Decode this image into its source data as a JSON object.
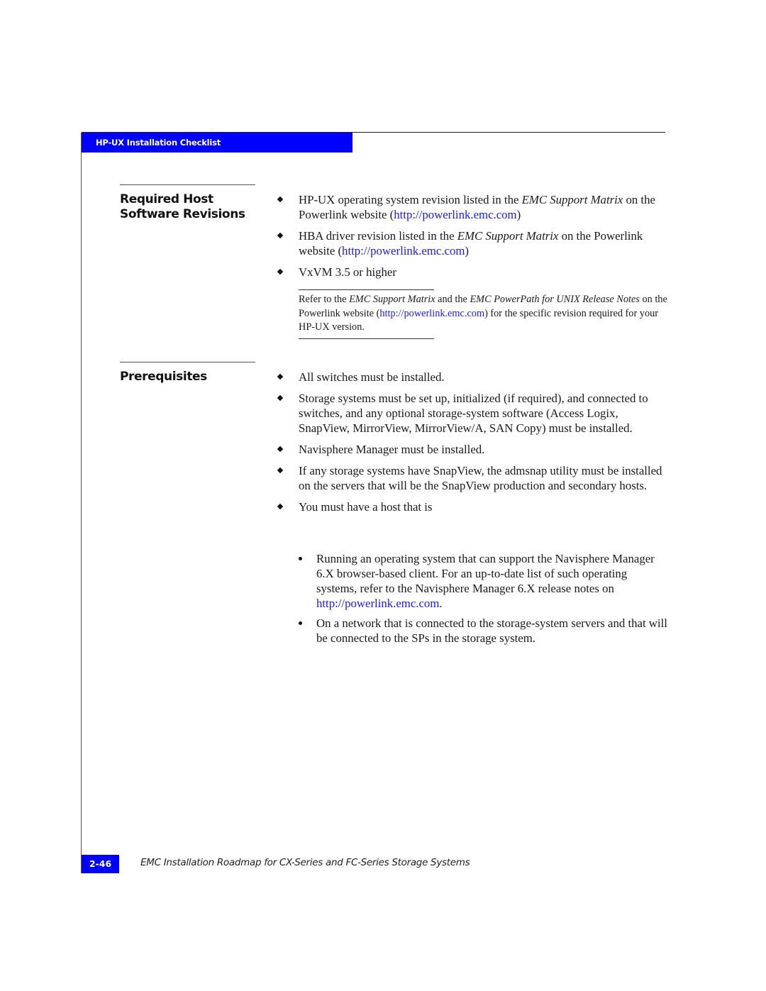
{
  "header": {
    "section_banner": "HP-UX Installation Checklist",
    "banner_color": "#0000ff"
  },
  "sections": {
    "required_host": {
      "heading_line1": "Required Host",
      "heading_line2": "Software Revisions",
      "items": [
        {
          "pre": "HP-UX operating system revision listed in the ",
          "em": "EMC Support Matrix",
          "mid": " on the Powerlink website (",
          "link": "http://powerlink.emc.com",
          "post": ")"
        },
        {
          "pre": "HBA driver revision listed in the ",
          "em": "EMC Support Matrix",
          "mid": " on the Powerlink website (",
          "link": "http://powerlink.emc.com",
          "post": ")"
        },
        {
          "text": "VxVM 3.5 or higher"
        }
      ],
      "note": {
        "t1": "Refer to the ",
        "em1": "EMC Support Matrix",
        "t2": " and the ",
        "em2": "EMC PowerPath for UNIX Release Notes",
        "t3": " on the Powerlink website (",
        "link": "http://powerlink.emc.com",
        "t4": ") for the specific revision required for your HP-UX version."
      }
    },
    "prerequisites": {
      "heading": "Prerequisites",
      "items": [
        "All switches must be installed.",
        "Storage systems must be set up, initialized (if required), and connected to switches, and any optional storage-system software (Access Logix, SnapView, MirrorView, MirrorView/A, SAN Copy) must be installed.",
        "Navisphere Manager must be installed.",
        "If any storage systems have SnapView, the admsnap utility must be installed on the servers that will be the SnapView production and secondary hosts.",
        "You must have a host that is"
      ],
      "subitems": [
        {
          "pre": "Running an operating system that can support the Navisphere Manager 6.X browser-based client. For an up-to-date list of such operating systems, refer to the Navisphere Manager 6.X release notes on ",
          "link": "http://powerlink.emc.com",
          "post": "."
        },
        {
          "text": "On a network that is connected to the storage-system servers and that will be connected to the SPs in the storage system."
        }
      ]
    }
  },
  "footer": {
    "page_number": "2-46",
    "book_title": "EMC Installation Roadmap for CX-Series and FC-Series Storage Systems"
  },
  "colors": {
    "link": "#1a1aff"
  }
}
